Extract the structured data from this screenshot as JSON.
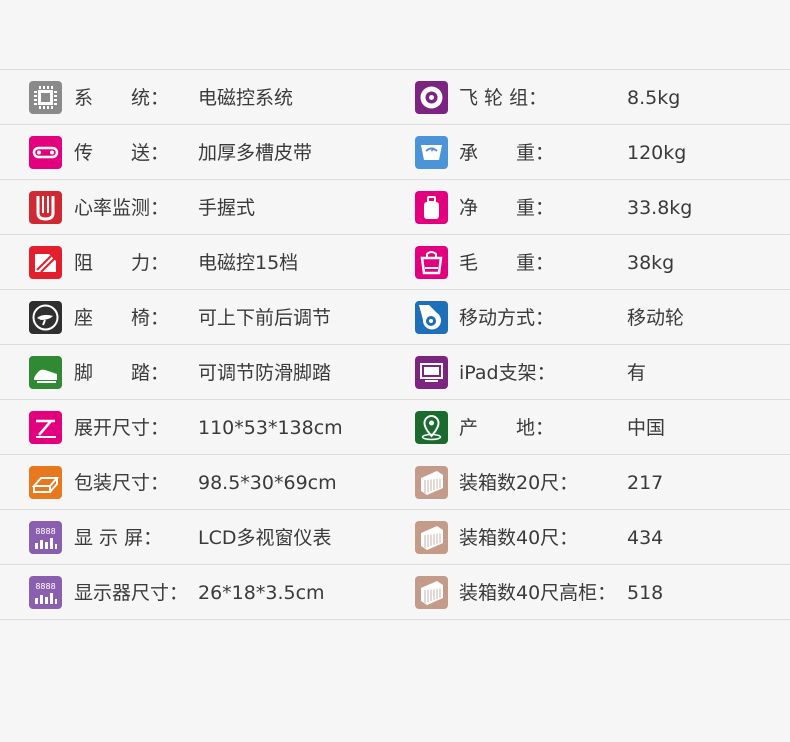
{
  "rows": [
    {
      "left": {
        "icon": "chip-icon",
        "color": "#8a8a8a",
        "label": "系　　统：",
        "value": "电磁控系统"
      },
      "right": {
        "icon": "flywheel-icon",
        "color": "#7b2480",
        "label": "飞 轮 组：",
        "value": "8.5kg"
      }
    },
    {
      "left": {
        "icon": "belt-icon",
        "color": "#e3007f",
        "label": "传　　送：",
        "value": "加厚多槽皮带"
      },
      "right": {
        "icon": "scale-icon",
        "color": "#4b94d8",
        "label": "承　　重：",
        "value": "120kg"
      }
    },
    {
      "left": {
        "icon": "handgrip-icon",
        "color": "#cf2a34",
        "label": "心率监测：",
        "value": "手握式"
      },
      "right": {
        "icon": "weight-icon",
        "color": "#e3007f",
        "label": "净　　重：",
        "value": "33.8kg"
      }
    },
    {
      "left": {
        "icon": "resistance-icon",
        "color": "#e31e2d",
        "label": "阻　　力：",
        "value": "电磁控15档"
      },
      "right": {
        "icon": "bag-icon",
        "color": "#e3007f",
        "label": "毛　　重：",
        "value": "38kg"
      }
    },
    {
      "left": {
        "icon": "seat-icon",
        "color": "#2f2f2f",
        "label": "座　　椅：",
        "value": "可上下前后调节"
      },
      "right": {
        "icon": "wheel-icon",
        "color": "#1c6fb8",
        "label": "移动方式：",
        "value": "移动轮"
      }
    },
    {
      "left": {
        "icon": "pedal-icon",
        "color": "#2f8a33",
        "label": "脚　　踏：",
        "value": "可调节防滑脚踏"
      },
      "right": {
        "icon": "tablet-icon",
        "color": "#7b2480",
        "label": "iPad支架：",
        "value": "有"
      }
    },
    {
      "left": {
        "icon": "ruler-icon",
        "color": "#e3007f",
        "label": "展开尺寸：",
        "value": "110*53*138cm"
      },
      "right": {
        "icon": "location-icon",
        "color": "#1b6b2e",
        "label": "产　　地：",
        "value": "中国"
      }
    },
    {
      "left": {
        "icon": "box-icon",
        "color": "#e8781e",
        "label": "包装尺寸：",
        "value": "98.5*30*69cm"
      },
      "right": {
        "icon": "container-icon",
        "color": "#c49a88",
        "label": "装箱数20尺：",
        "value": "217"
      }
    },
    {
      "left": {
        "icon": "display-icon",
        "color": "#8b5fb0",
        "label": "显 示 屏：",
        "value": "LCD多视窗仪表"
      },
      "right": {
        "icon": "container-icon",
        "color": "#c49a88",
        "label": "装箱数40尺：",
        "value": "434"
      }
    },
    {
      "left": {
        "icon": "display-icon",
        "color": "#8b5fb0",
        "label": "显示器尺寸：",
        "value": "26*18*3.5cm"
      },
      "right": {
        "icon": "container-icon",
        "color": "#c49a88",
        "label": "装箱数40尺高柜：",
        "value": "518"
      }
    }
  ]
}
